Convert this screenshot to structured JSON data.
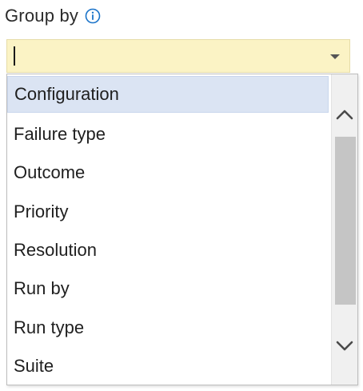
{
  "group_by": {
    "label": "Group by",
    "info_icon": "info-circle-icon",
    "input_value": "",
    "dropdown_icon": "chevron-down-icon"
  },
  "dropdown": {
    "selected": "Configuration",
    "items": [
      "Configuration",
      "Failure type",
      "Outcome",
      "Priority",
      "Resolution",
      "Run by",
      "Run type",
      "Suite"
    ],
    "scroll_up_icon": "chevron-up-icon",
    "scroll_down_icon": "chevron-down-icon"
  },
  "colors": {
    "input_background": "#fbf3c5",
    "selected_item_background": "#dbe4f3",
    "info_icon": "#1a73c9",
    "scroll_thumb": "#c5c5c5"
  }
}
